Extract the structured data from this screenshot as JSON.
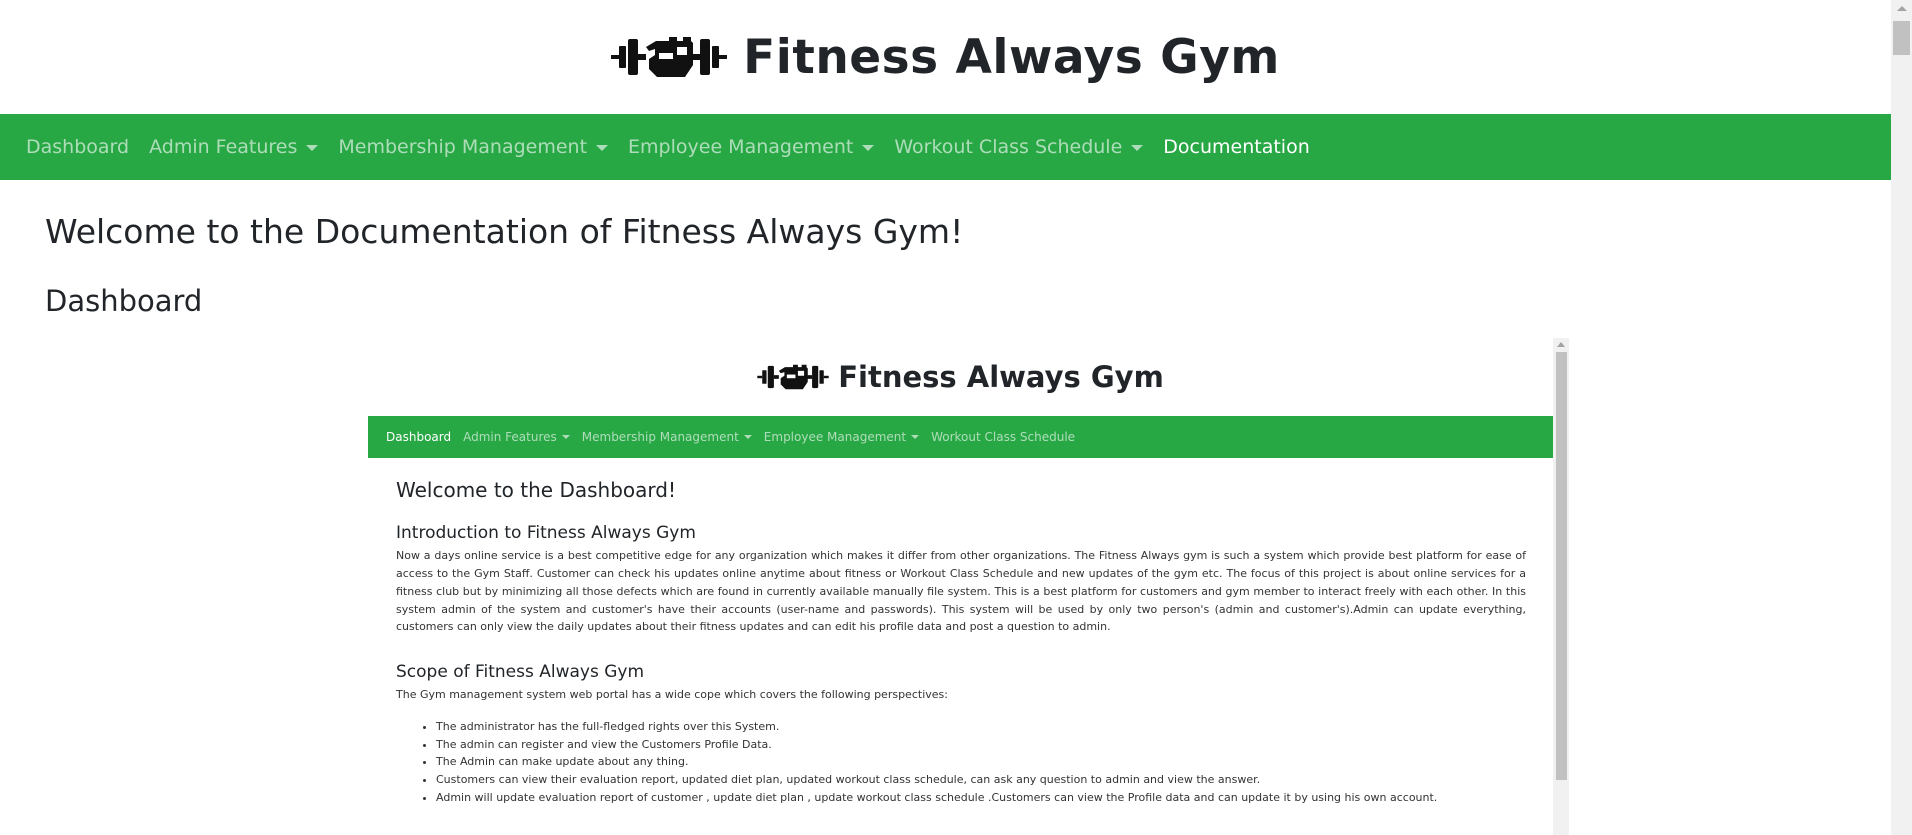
{
  "header": {
    "title": "Fitness Always Gym",
    "logo_icon": "dumbbell-fist-icon"
  },
  "navbar": {
    "items": [
      {
        "label": "Dashboard"
      },
      {
        "label": "Admin Features"
      },
      {
        "label": "Membership Management"
      },
      {
        "label": "Employee Management"
      },
      {
        "label": "Workout Class Schedule"
      },
      {
        "label": "Documentation"
      }
    ],
    "active": "Documentation"
  },
  "main": {
    "heading": "Welcome to the Documentation of Fitness Always Gym!",
    "section_title": "Dashboard"
  },
  "screenshot": {
    "title": "Fitness Always Gym",
    "nav": [
      {
        "label": "Dashboard"
      },
      {
        "label": "Admin Features"
      },
      {
        "label": "Membership Management"
      },
      {
        "label": "Employee Management"
      },
      {
        "label": "Workout Class Schedule"
      }
    ],
    "welcome": "Welcome to the Dashboard!",
    "intro_title": "Introduction to Fitness Always Gym",
    "intro_text": "Now a days online service is a best competitive edge for any organization which makes it differ from other organizations. The Fitness Always gym is such a system which provide best platform for ease of access to the Gym Staff. Customer can check his updates online anytime about fitness or Workout Class Schedule and new updates of the gym etc. The focus of this project is about online services for a fitness club but by minimizing all those defects which are found in currently available manually file system. This is a best platform for customers and gym member to interact freely with each other. In this system admin of the system and customer's have their accounts (user-name and passwords). This system will be used by only two person's (admin and customer's).Admin can update everything, customers can only view the daily updates about their fitness updates and can edit his profile data and post a question to admin.",
    "scope_title": "Scope of Fitness Always Gym",
    "scope_text": "The Gym management system web portal has a wide cope which covers the following perspectives:",
    "scope_items": [
      "The administrator has the full-fledged rights over this System.",
      "The admin can register and view the Customers Profile Data.",
      "The Admin can make update about any thing.",
      "Customers can view their evaluation report, updated diet plan, updated workout class schedule, can ask any question to admin and view the answer.",
      "Admin will update evaluation report of customer , update diet plan , update workout class schedule .Customers can view the Profile data and can update it by using his own account."
    ]
  },
  "colors": {
    "navbar_bg": "#28a745",
    "nav_text": "#ffffffa0",
    "nav_active": "#ffffff",
    "text": "#212529"
  }
}
